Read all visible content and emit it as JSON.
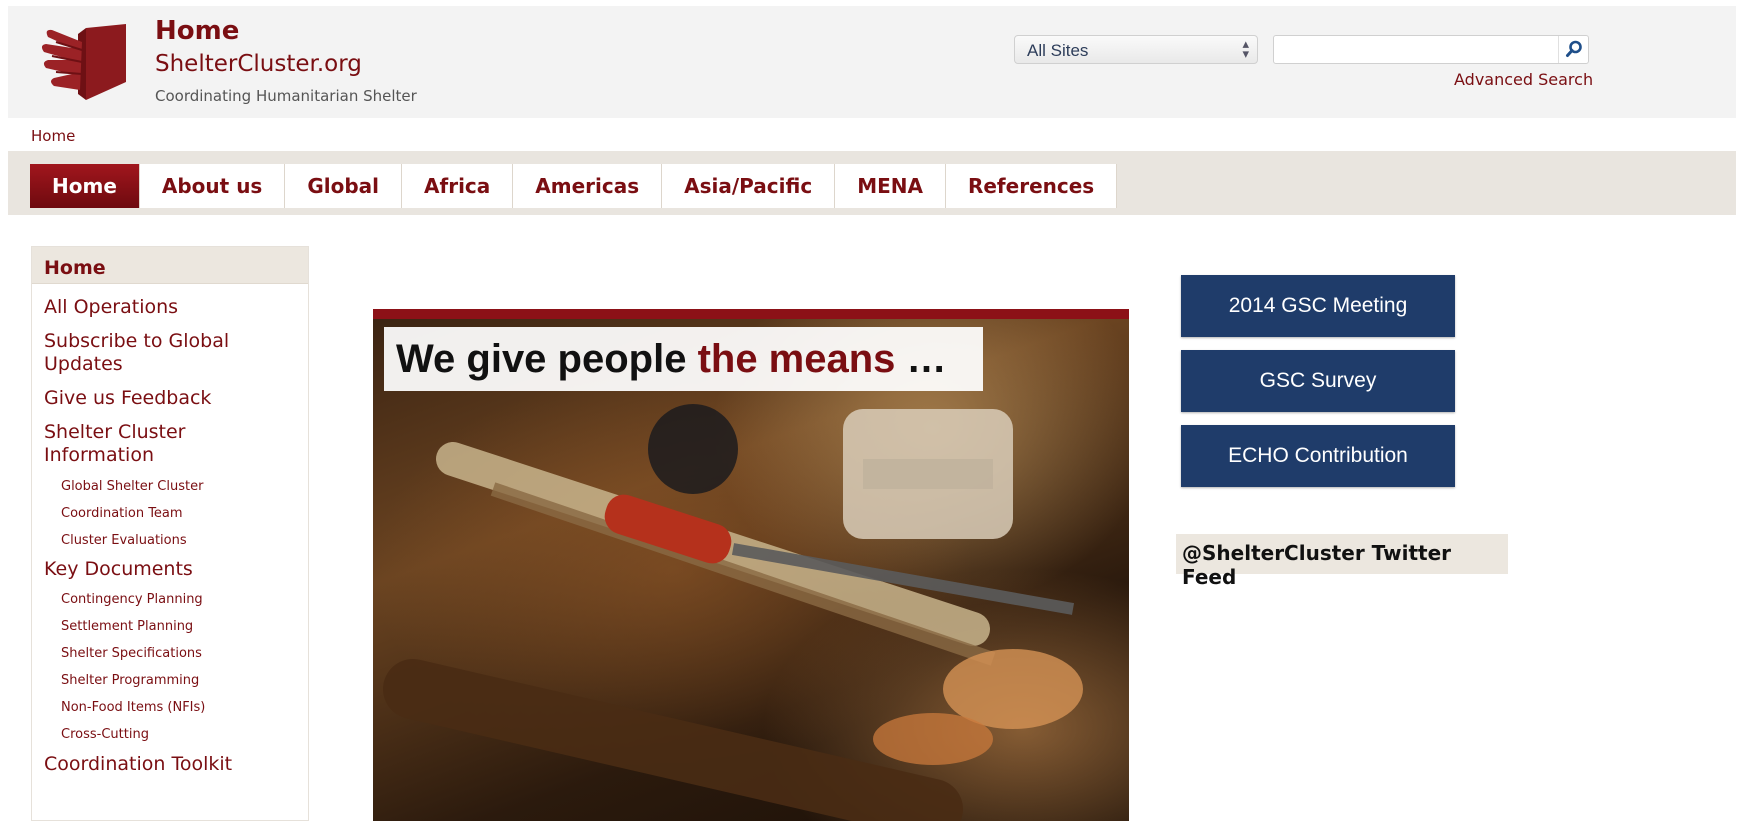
{
  "header": {
    "logo_icon": "shelter-hands-logo",
    "title": "Home",
    "site_name": "ShelterCluster.org",
    "tagline": "Coordinating Humanitarian Shelter",
    "site_select": {
      "selected": "All Sites",
      "icon": "updown-arrows-icon"
    },
    "search": {
      "value": "",
      "placeholder": "",
      "icon": "search-icon"
    },
    "advanced_search": "Advanced Search"
  },
  "breadcrumb": "Home",
  "nav": {
    "items": [
      "Home",
      "About us",
      "Global",
      "Africa",
      "Americas",
      "Asia/Pacific",
      "MENA",
      "References"
    ],
    "active": "Home"
  },
  "sidebar": {
    "heading": "Home",
    "items": [
      {
        "label": "All Operations"
      },
      {
        "label": "Subscribe to Global Updates"
      },
      {
        "label": "Give us Feedback"
      },
      {
        "label": "Shelter Cluster Information"
      },
      {
        "label": "Global Shelter Cluster"
      },
      {
        "label": "Coordination Team"
      },
      {
        "label": "Cluster Evaluations"
      },
      {
        "label": "Key Documents"
      },
      {
        "label": "Contingency Planning"
      },
      {
        "label": "Settlement Planning"
      },
      {
        "label": "Shelter Specifications"
      },
      {
        "label": "Shelter Programming"
      },
      {
        "label": "Non-Food Items (NFIs)"
      },
      {
        "label": "Cross-Cutting"
      },
      {
        "label": "Coordination Toolkit"
      }
    ]
  },
  "hero": {
    "caption_start": "We give people ",
    "caption_highlight": "the means",
    "caption_end": " …"
  },
  "right": {
    "buttons": [
      "2014 GSC Meeting",
      "GSC Survey",
      "ECHO Contribution"
    ],
    "twitter_heading": "@ShelterCluster Twitter Feed"
  },
  "colors": {
    "brand": "#7a0e12",
    "button_blue": "#1f3c6a",
    "nav_bg": "#e9e5df"
  }
}
